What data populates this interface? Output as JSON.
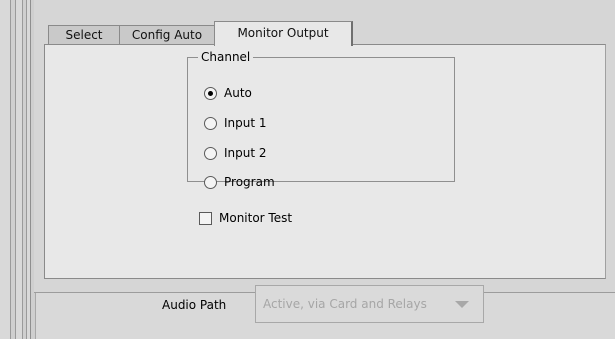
{
  "tabs": [
    {
      "label": "Select",
      "active": false
    },
    {
      "label": "Config Auto",
      "active": false
    },
    {
      "label": "Monitor Output",
      "active": true
    }
  ],
  "channel": {
    "legend": "Channel",
    "options": [
      {
        "label": "Auto",
        "selected": true
      },
      {
        "label": "Input 1",
        "selected": false
      },
      {
        "label": "Input 2",
        "selected": false
      },
      {
        "label": "Program",
        "selected": false
      }
    ]
  },
  "monitor_test": {
    "label": "Monitor Test",
    "checked": false
  },
  "audio_path": {
    "label": "Audio Path",
    "value": "Active, via Card and Relays",
    "enabled": false
  }
}
